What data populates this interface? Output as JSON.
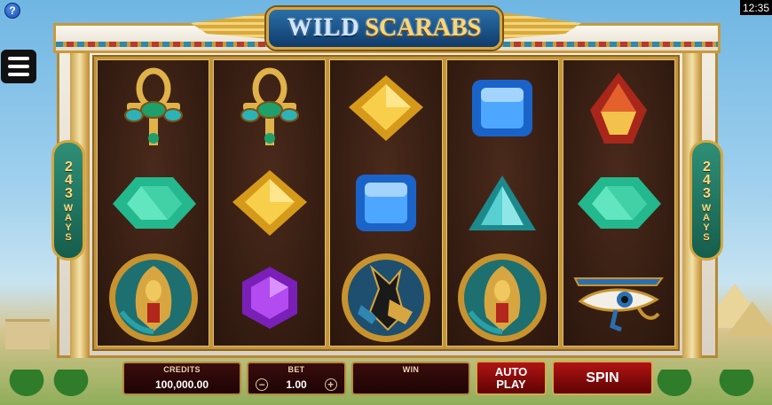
{
  "game": {
    "logo_word_1": "WILD",
    "logo_word_2": "SCARABS",
    "ways_number": "243",
    "ways_label": "WAYS"
  },
  "status_bar": {
    "time": "12:35",
    "help_label": "?"
  },
  "reels": [
    [
      "ankh-scarab",
      "green-emerald",
      "scarab-medallion"
    ],
    [
      "ankh-scarab",
      "yellow-diamond",
      "purple-gem"
    ],
    [
      "yellow-diamond",
      "blue-square-gem",
      "anubis-medallion"
    ],
    [
      "blue-square-gem",
      "cyan-triangle-gem",
      "scarab-medallion"
    ],
    [
      "red-gem",
      "green-emerald",
      "eye-of-horus"
    ]
  ],
  "controls": {
    "credits_label": "CREDITS",
    "credits_value": "100,000.00",
    "bet_label": "BET",
    "bet_value": "1.00",
    "bet_minus": "−",
    "bet_plus": "+",
    "win_label": "WIN",
    "win_value": "",
    "autoplay_label_1": "AUTO",
    "autoplay_label_2": "PLAY",
    "spin_label": "SPIN"
  },
  "colors": {
    "spin_button": "#b11414",
    "panel_bg": "#2a0606",
    "gold_trim": "#d5a640"
  }
}
